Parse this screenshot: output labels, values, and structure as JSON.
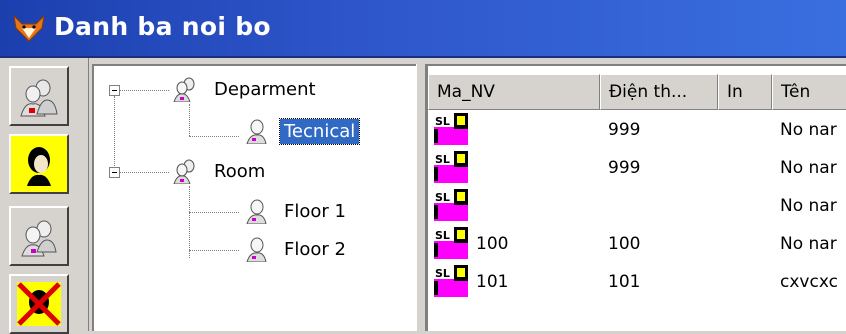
{
  "window": {
    "title": "Danh ba noi bo",
    "icon": "fox-head-icon"
  },
  "toolbar": {
    "buttons": [
      {
        "icon": "group-people-icon"
      },
      {
        "icon": "person-head-yellow-icon"
      },
      {
        "icon": "people-pair-icon"
      },
      {
        "icon": "person-removed-icon"
      }
    ]
  },
  "tree": {
    "root1": {
      "label": "Deparment",
      "children": [
        {
          "label": "Tecnical",
          "selected": true
        }
      ]
    },
    "root2": {
      "label": "Room",
      "children": [
        {
          "label": "Floor 1"
        },
        {
          "label": "Floor 2"
        }
      ]
    }
  },
  "list": {
    "columns": [
      "Ma_NV",
      "Điện th...",
      "In",
      "Tên"
    ],
    "rows": [
      {
        "ma_nv": "",
        "dien_thoai": "999",
        "in": "",
        "ten": "No nar"
      },
      {
        "ma_nv": "",
        "dien_thoai": "999",
        "in": "",
        "ten": "No nar"
      },
      {
        "ma_nv": "",
        "dien_thoai": "",
        "in": "",
        "ten": "No nar"
      },
      {
        "ma_nv": "100",
        "dien_thoai": "100",
        "in": "",
        "ten": "No nar"
      },
      {
        "ma_nv": "101",
        "dien_thoai": "101",
        "in": "",
        "ten": "cxvcxc"
      }
    ],
    "row_icon_text": "SL"
  },
  "colors": {
    "title_bar": "#2d55c9",
    "selection": "#316ac5",
    "face": "#d6d3ce",
    "icon_magenta": "#ff00ff",
    "icon_yellow": "#ffff00"
  }
}
